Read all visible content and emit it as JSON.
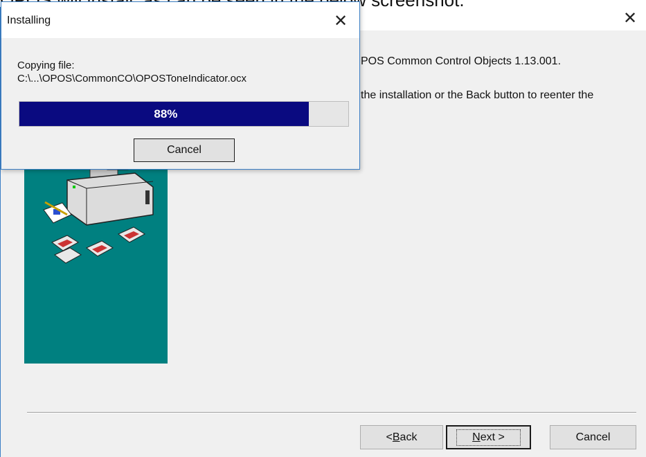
{
  "document": {
    "caption_text": "OPOS will install, as can be seen in the below screenshot."
  },
  "wizard": {
    "close_glyph": "✕",
    "info_line1": "POS Common Control Objects 1.13.001.",
    "info_line2": "the installation or the Back button to reenter the",
    "buttons": {
      "back_prefix": "< ",
      "back_mnemonic": "B",
      "back_rest": "ack",
      "next_mnemonic": "N",
      "next_rest": "ext >",
      "cancel": "Cancel"
    }
  },
  "installing_dialog": {
    "title": "Installing",
    "close_glyph": "✕",
    "copying_label": "Copying file:",
    "file_path": "C:\\...\\OPOS\\CommonCO\\OPOSToneIndicator.ocx",
    "progress_percent": 88,
    "progress_text": "88%",
    "cancel_label": "Cancel"
  },
  "colors": {
    "accent_border": "#3c7fc5",
    "progress_fill": "#0a0a80",
    "art_background": "#008080"
  },
  "icons": [
    "close-icon",
    "computer-illustration",
    "floppy-disk-icon",
    "clipboard-icon"
  ]
}
